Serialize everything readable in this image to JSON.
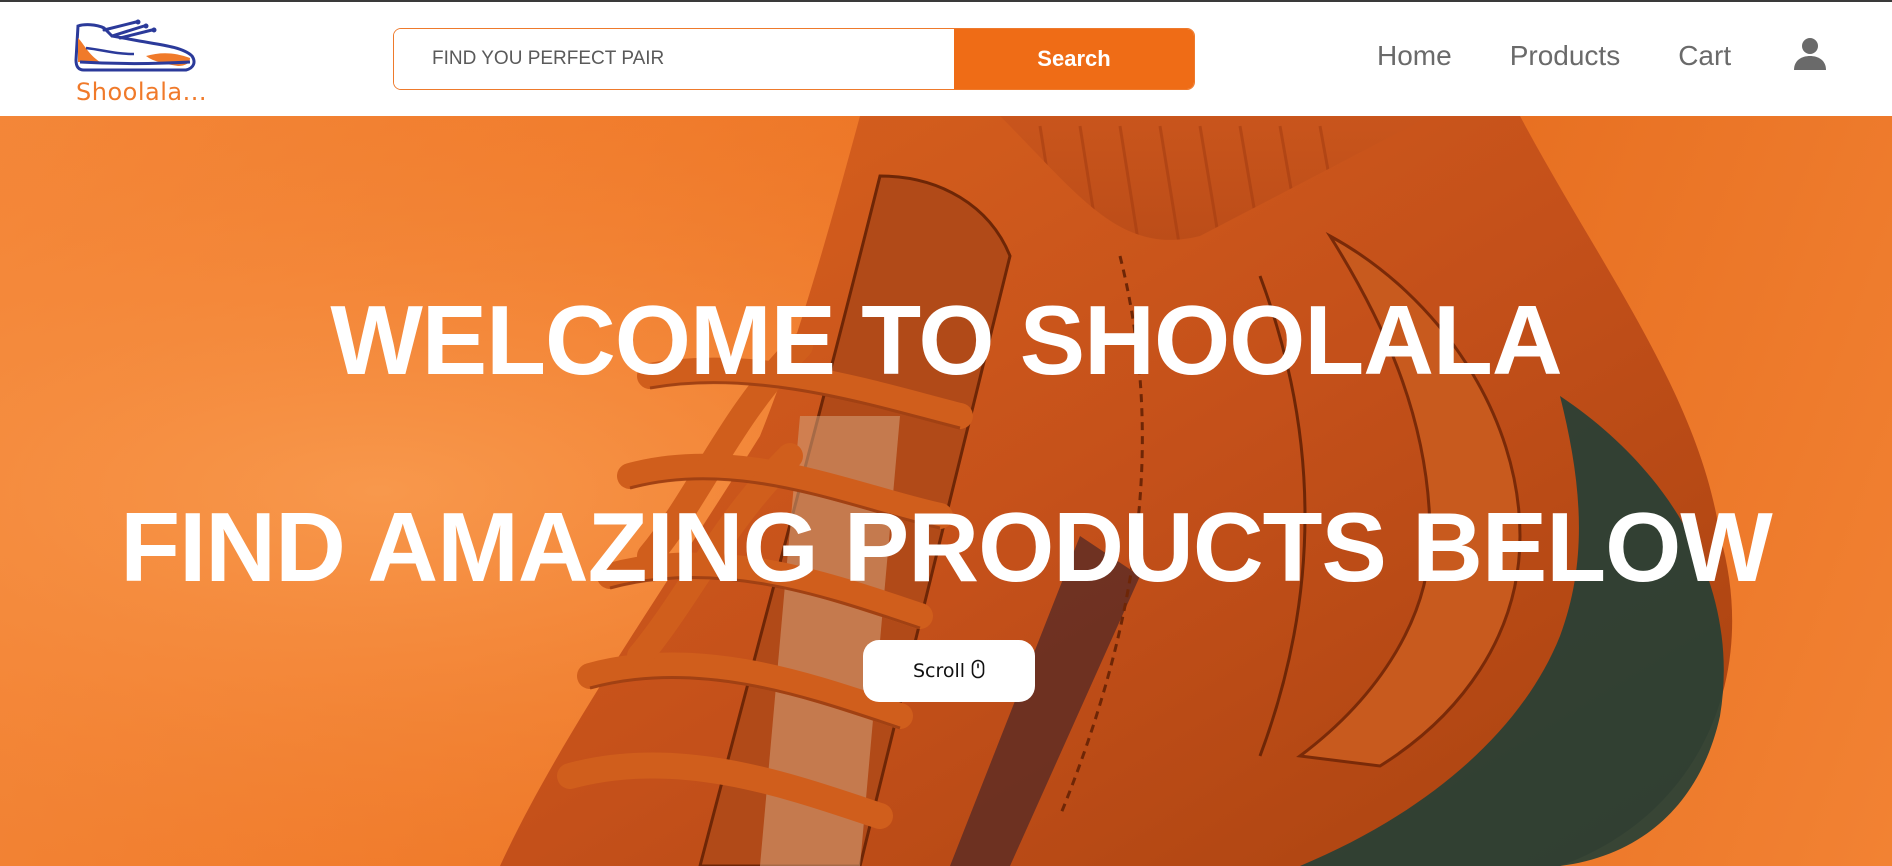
{
  "header": {
    "logo_text": "Shoolala...",
    "logo_icon": "sneaker-logo-icon",
    "search": {
      "placeholder": "FIND YOU PERFECT PAIR",
      "value": "",
      "button_label": "Search"
    },
    "nav": [
      {
        "label": "Home"
      },
      {
        "label": "Products"
      },
      {
        "label": "Cart"
      }
    ],
    "user_icon": "user-icon"
  },
  "hero": {
    "line1": "WELCOME TO SHOOLALA",
    "line2": "FIND AMAZING PRODUCTS BELOW",
    "scroll_label": "Scroll",
    "scroll_icon": "mouse-icon"
  },
  "colors": {
    "brand_orange": "#ef6c16",
    "logo_blue": "#2b3a9a",
    "nav_text": "#6a6a6a",
    "hero_text": "#ffffff"
  }
}
